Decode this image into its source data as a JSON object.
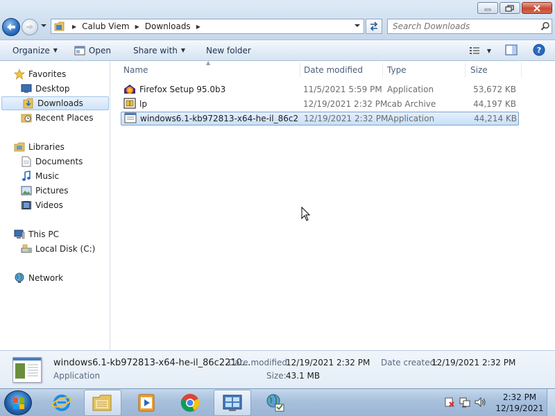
{
  "window": {
    "controls": {
      "minimize": "minimize-icon",
      "maximize": "maximize-icon",
      "close": "close-icon"
    }
  },
  "address": {
    "breadcrumbs": [
      "Calub Viem",
      "Downloads"
    ]
  },
  "search": {
    "placeholder": "Search Downloads"
  },
  "toolbar": {
    "organize": "Organize",
    "open": "Open",
    "share_with": "Share with",
    "new_folder": "New folder"
  },
  "nav": {
    "favorites": "Favorites",
    "desktop": "Desktop",
    "downloads": "Downloads",
    "recent": "Recent Places",
    "libraries": "Libraries",
    "documents": "Documents",
    "music": "Music",
    "pictures": "Pictures",
    "videos": "Videos",
    "thispc": "This PC",
    "localdisk": "Local Disk (C:)",
    "network": "Network"
  },
  "columns": {
    "name": "Name",
    "date": "Date modified",
    "type": "Type",
    "size": "Size"
  },
  "files": [
    {
      "name": "Firefox Setup 95.0b3",
      "date": "11/5/2021 5:59 PM",
      "type": "Application",
      "size": "53,672 KB",
      "icon": "firefox-setup-icon"
    },
    {
      "name": "lp",
      "date": "12/19/2021 2:32 PM",
      "type": "cab Archive",
      "size": "44,197 KB",
      "icon": "cab-archive-icon"
    },
    {
      "name": "windows6.1-kb972813-x64-he-il_86c2210...",
      "date": "12/19/2021 2:32 PM",
      "type": "Application",
      "size": "44,214 KB",
      "icon": "application-icon"
    }
  ],
  "details": {
    "name": "windows6.1-kb972813-x64-he-il_86c2210...",
    "kind": "Application",
    "date_modified_label": "Date modified:",
    "date_modified": "12/19/2021 2:32 PM",
    "date_created_label": "Date created:",
    "date_created": "12/19/2021 2:32 PM",
    "size_label": "Size:",
    "size": "43.1 MB"
  },
  "taskbar": {
    "time": "2:32 PM",
    "date": "12/19/2021"
  },
  "colors": {
    "selection": "#cfe3fa",
    "accent": "#2a6cc0"
  }
}
